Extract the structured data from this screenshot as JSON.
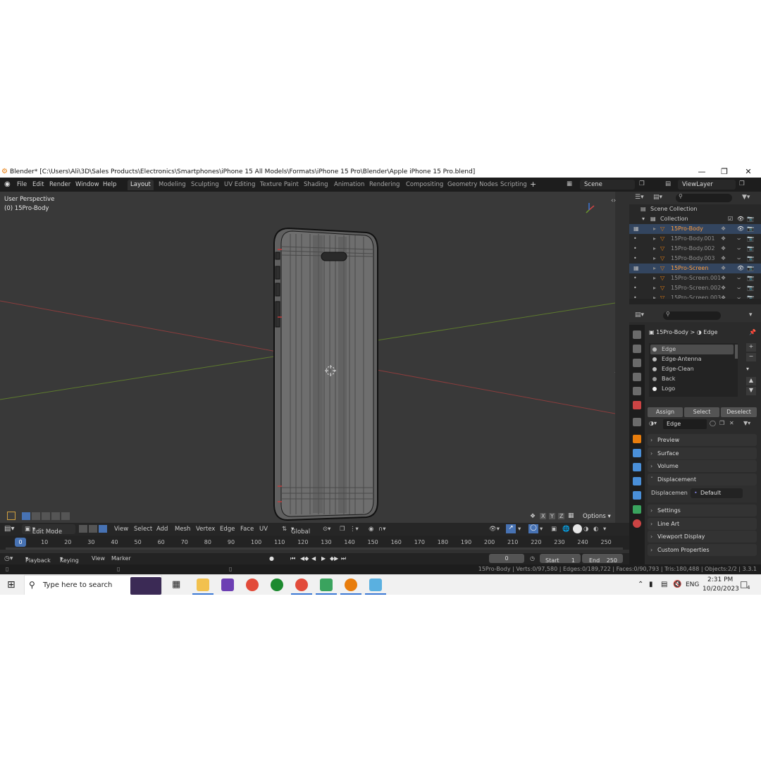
{
  "window": {
    "title": "Blender* [C:\\Users\\Ali\\3D\\Sales Products\\Electronics\\Smartphones\\iPhone 15 All Models\\Formats\\iPhone 15 Pro\\Blender\\Apple iPhone 15 Pro.blend]",
    "minimize": "—",
    "maximize": "❐",
    "close": "✕"
  },
  "menu": [
    "File",
    "Edit",
    "Render",
    "Window",
    "Help"
  ],
  "workspaces": [
    "Layout",
    "Modeling",
    "Sculpting",
    "UV Editing",
    "Texture Paint",
    "Shading",
    "Animation",
    "Rendering",
    "Compositing",
    "Geometry Nodes",
    "Scripting"
  ],
  "add_workspace": "+",
  "scene": "Scene",
  "view_layer": "ViewLayer",
  "viewport": {
    "perspective": "User Perspective",
    "object": "(0) 15Pro-Body",
    "options": "Options",
    "axes": [
      "X",
      "Y",
      "Z"
    ]
  },
  "toolbar": {
    "mode": "Edit Mode",
    "items": [
      "View",
      "Select",
      "Add",
      "Mesh",
      "Vertex",
      "Edge",
      "Face",
      "UV"
    ],
    "transform": "Global"
  },
  "outliner": {
    "root": "Scene Collection",
    "collection": "Collection",
    "items": [
      {
        "name": "15Pro-Body",
        "state": "active"
      },
      {
        "name": "15Pro-Body.001",
        "state": "hidden"
      },
      {
        "name": "15Pro-Body.002",
        "state": "hidden"
      },
      {
        "name": "15Pro-Body.003",
        "state": "hidden"
      },
      {
        "name": "15Pro-Screen",
        "state": "active"
      },
      {
        "name": "15Pro-Screen.001",
        "state": "hidden"
      },
      {
        "name": "15Pro-Screen.002",
        "state": "hidden"
      },
      {
        "name": "15Pro-Screen.003",
        "state": "hidden"
      }
    ]
  },
  "properties": {
    "breadcrumb_object": "15Pro-Body",
    "breadcrumb_sep": ">",
    "breadcrumb_material": "Edge",
    "material_slots": [
      "Edge",
      "Edge-Antenna",
      "Edge-Clean",
      "Back",
      "Logo"
    ],
    "assign": "Assign",
    "select": "Select",
    "deselect": "Deselect",
    "material_name": "Edge",
    "panels": [
      "Preview",
      "Surface",
      "Volume",
      "Displacement"
    ],
    "displacement_label": "Displacemen",
    "displacement_value": "Default",
    "panels_after": [
      "Settings",
      "Line Art",
      "Viewport Display",
      "Custom Properties"
    ]
  },
  "timeline": {
    "current_frame_marker": "0",
    "ticks": [
      "0",
      "10",
      "20",
      "30",
      "40",
      "50",
      "60",
      "70",
      "80",
      "90",
      "100",
      "110",
      "120",
      "130",
      "140",
      "150",
      "160",
      "170",
      "180",
      "190",
      "200",
      "210",
      "220",
      "230",
      "240",
      "250"
    ],
    "menus": [
      "Playback",
      "Keying",
      "View",
      "Marker"
    ],
    "frame": "0",
    "start_label": "Start",
    "start": "1",
    "end_label": "End",
    "end": "250"
  },
  "status": "15Pro-Body | Verts:0/97,580 | Edges:0/189,722 | Faces:0/90,793 | Tris:180,488 | Objects:2/2 | 3.3.1",
  "taskbar": {
    "search_placeholder": "Type here to search",
    "language": "ENG",
    "time": "2:31 PM",
    "date": "10/20/2023",
    "notifications": "4"
  }
}
